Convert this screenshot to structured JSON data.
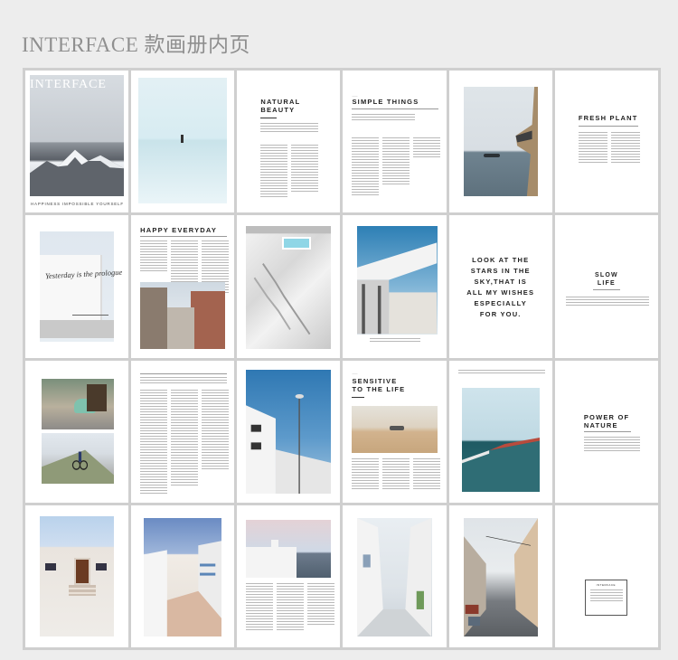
{
  "page_title": "INTERFACE 款画册内页",
  "pages": {
    "cover": {
      "masthead": "INTERFACE",
      "tagline": "HAPPINESS IMPOSSIBLE YOURSELF"
    },
    "natural_beauty": {
      "heading": "NATURAL\nBEAUTY"
    },
    "simple_things": {
      "heading": "SIMPLE THINGS"
    },
    "fresh_plant": {
      "heading": "FRESH PLANT"
    },
    "white_wall": {
      "sign": "Yesterday is the prologue"
    },
    "happy_everyday": {
      "heading": "HAPPY EVERYDAY"
    },
    "stars_quote": {
      "text": "LOOK AT THE\nSTARS IN THE\nSKY,THAT IS\nALL MY WISHES\nESPECIALLY\nFOR YOU."
    },
    "slow_life": {
      "heading": "SLOW\nLIFE"
    },
    "sensitive": {
      "heading": "SENSITIVE\nTO THE LIFE"
    },
    "power_nature": {
      "heading": "POWER OF\nNATURE"
    },
    "last_page": {
      "box_title": "INTERFACE"
    }
  },
  "colors": {
    "background": "#ededed",
    "grid_border": "#cfcfcf",
    "title_gray": "#8f8f8f"
  }
}
